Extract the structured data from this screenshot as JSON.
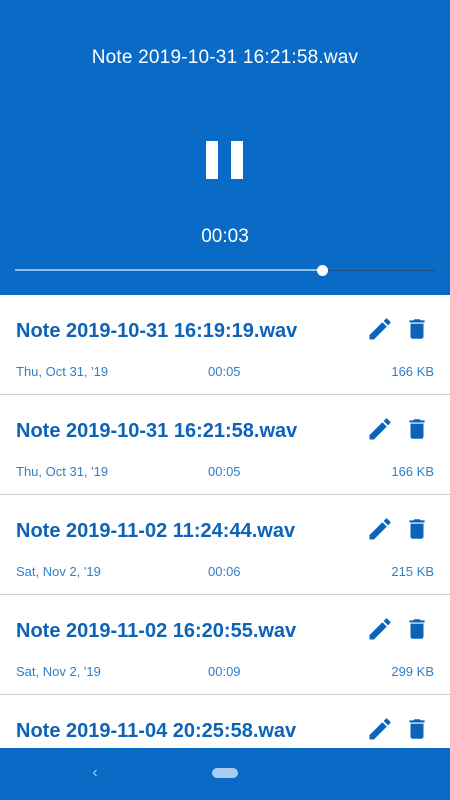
{
  "player": {
    "title": "Note 2019-10-31 16:21:58.wav",
    "elapsed": "00:03",
    "progress_fraction": 0.73,
    "pause_icon": "pause-icon",
    "accent_color": "#0a6bc7"
  },
  "recordings": [
    {
      "name": "Note 2019-10-31 16:19:19.wav",
      "date": "Thu, Oct 31, '19",
      "duration": "00:05",
      "size": "166 KB"
    },
    {
      "name": "Note 2019-10-31 16:21:58.wav",
      "date": "Thu, Oct 31, '19",
      "duration": "00:05",
      "size": "166 KB"
    },
    {
      "name": "Note 2019-11-02 11:24:44.wav",
      "date": "Sat, Nov 2, '19",
      "duration": "00:06",
      "size": "215 KB"
    },
    {
      "name": "Note 2019-11-02 16:20:55.wav",
      "date": "Sat, Nov 2, '19",
      "duration": "00:09",
      "size": "299 KB"
    },
    {
      "name": "Note 2019-11-04 20:25:58.wav",
      "date": "",
      "duration": "",
      "size": ""
    }
  ],
  "icons": {
    "edit": "pencil-icon",
    "delete": "trash-icon",
    "back": "chevron-left-icon",
    "home": "home-pill-icon"
  },
  "nav": {
    "back_glyph": "‹"
  }
}
